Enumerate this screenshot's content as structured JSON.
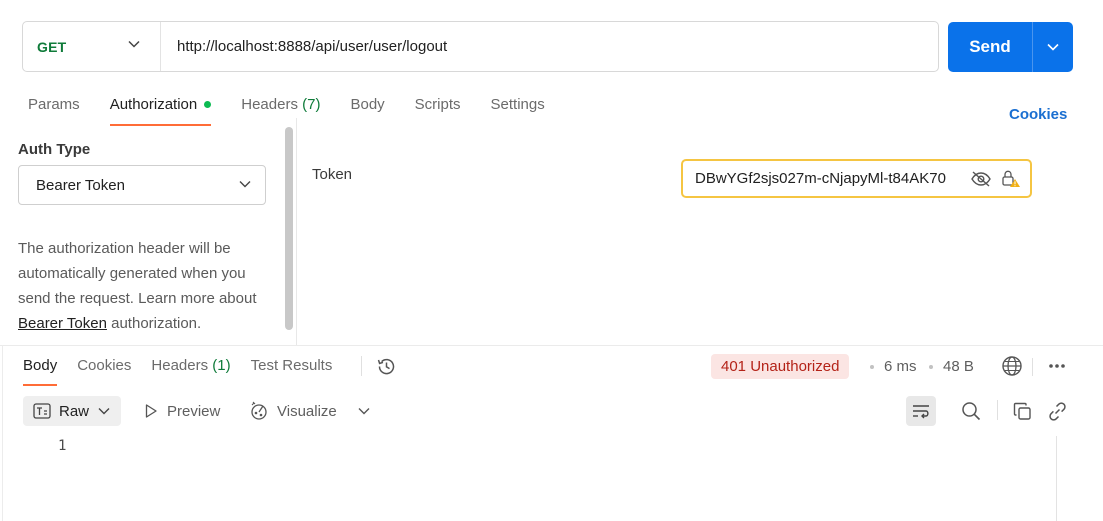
{
  "request": {
    "method": "GET",
    "url": "http://localhost:8888/api/user/user/logout",
    "send_label": "Send"
  },
  "request_tabs": [
    {
      "label": "Params"
    },
    {
      "label": "Authorization"
    },
    {
      "label": "Headers",
      "count": "(7)"
    },
    {
      "label": "Body"
    },
    {
      "label": "Scripts"
    },
    {
      "label": "Settings"
    }
  ],
  "cookies_link": "Cookies",
  "auth": {
    "type_title": "Auth Type",
    "type_value": "Bearer Token",
    "desc_before": "The authorization header will be automatically generated when you send the request. Learn more about ",
    "desc_link": "Bearer Token",
    "desc_after": " authorization.",
    "token_label": "Token",
    "token_value": "DBwYGf2sjs027m-cNjapyMl-t84AK70"
  },
  "response_tabs": [
    {
      "label": "Body"
    },
    {
      "label": "Cookies"
    },
    {
      "label": "Headers",
      "count": "(1)"
    },
    {
      "label": "Test Results"
    }
  ],
  "response_meta": {
    "status": "401 Unauthorized",
    "time": "6 ms",
    "size": "48 B"
  },
  "response_toolbar": {
    "format": "Raw",
    "preview": "Preview",
    "visualize": "Visualize"
  },
  "editor": {
    "line_numbers": [
      "1"
    ]
  },
  "colors": {
    "accent_orange": "#ff6c37",
    "send_blue": "#0a72ea",
    "method_green": "#0f7b3a",
    "status_error": "#b42318"
  }
}
